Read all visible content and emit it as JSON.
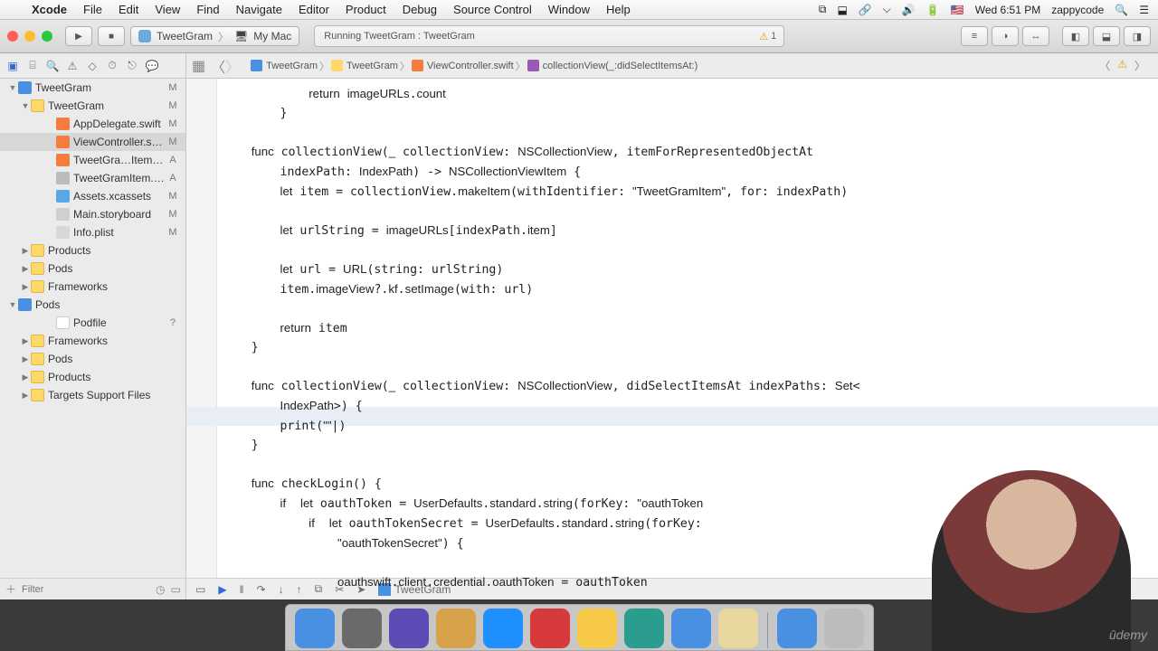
{
  "menubar": {
    "app": "Xcode",
    "items": [
      "File",
      "Edit",
      "View",
      "Find",
      "Navigate",
      "Editor",
      "Product",
      "Debug",
      "Source Control",
      "Window",
      "Help"
    ],
    "clock": "Wed 6:51 PM",
    "user": "zappycode",
    "flag": "🇺🇸"
  },
  "toolbar": {
    "scheme_name": "TweetGram",
    "destination": "My Mac",
    "activity": "Running TweetGram : TweetGram",
    "warning_count": "1"
  },
  "jumpbar": {
    "segments": [
      "TweetGram",
      "TweetGram",
      "ViewController.swift",
      "collectionView(_:didSelectItemsAt:)"
    ]
  },
  "navigator": {
    "items": [
      {
        "name": "TweetGram",
        "icon": "proj",
        "status": "M",
        "indent": "ind1",
        "disc": "▼"
      },
      {
        "name": "TweetGram",
        "icon": "fold",
        "status": "M",
        "indent": "ind2",
        "disc": "▼"
      },
      {
        "name": "AppDelegate.swift",
        "icon": "swift",
        "status": "M",
        "indent": "ind3b",
        "disc": ""
      },
      {
        "name": "ViewController.swift",
        "icon": "swift",
        "status": "M",
        "indent": "ind3b",
        "disc": "",
        "sel": true
      },
      {
        "name": "TweetGra…Item.swift",
        "icon": "swift",
        "status": "A",
        "indent": "ind3b",
        "disc": ""
      },
      {
        "name": "TweetGramItem.xib",
        "icon": "xib",
        "status": "A",
        "indent": "ind3b",
        "disc": ""
      },
      {
        "name": "Assets.xcassets",
        "icon": "xc",
        "status": "M",
        "indent": "ind3b",
        "disc": ""
      },
      {
        "name": "Main.storyboard",
        "icon": "sb",
        "status": "M",
        "indent": "ind3b",
        "disc": ""
      },
      {
        "name": "Info.plist",
        "icon": "plist",
        "status": "M",
        "indent": "ind3b",
        "disc": ""
      },
      {
        "name": "Products",
        "icon": "fold",
        "status": "",
        "indent": "ind2",
        "disc": "▶"
      },
      {
        "name": "Pods",
        "icon": "fold",
        "status": "",
        "indent": "ind2",
        "disc": "▶"
      },
      {
        "name": "Frameworks",
        "icon": "fold",
        "status": "",
        "indent": "ind2",
        "disc": "▶"
      },
      {
        "name": "Pods",
        "icon": "proj",
        "status": "",
        "indent": "ind1",
        "disc": "▼"
      },
      {
        "name": "Podfile",
        "icon": "white",
        "status": "?",
        "indent": "ind3b",
        "disc": ""
      },
      {
        "name": "Frameworks",
        "icon": "fold",
        "status": "",
        "indent": "ind2",
        "disc": "▶"
      },
      {
        "name": "Pods",
        "icon": "fold",
        "status": "",
        "indent": "ind2",
        "disc": "▶"
      },
      {
        "name": "Products",
        "icon": "fold",
        "status": "",
        "indent": "ind2",
        "disc": "▶"
      },
      {
        "name": "Targets Support Files",
        "icon": "fold",
        "status": "",
        "indent": "ind2",
        "disc": "▶"
      }
    ],
    "filter_placeholder": "Filter"
  },
  "debugbar": {
    "scheme": "TweetGram"
  },
  "code_lines": [
    {
      "t": "            <kw>return</kw> <mb>imageURLs</mb>.<pr>count</pr>"
    },
    {
      "t": "        }"
    },
    {
      "t": ""
    },
    {
      "t": "    <kw>func</kw> collectionView(<kw>_</kw> collectionView: <ty>NSCollectionView</ty>, itemForRepresentedObjectAt"
    },
    {
      "t": "        indexPath: <ty>IndexPath</ty>) -> <ty>NSCollectionViewItem</ty> {"
    },
    {
      "t": "        <kw>let</kw> item = collectionView.<pr>makeItem</pr>(withIdentifier: <st>\"TweetGramItem\"</st>, for: indexPath)"
    },
    {
      "t": ""
    },
    {
      "t": "        <kw>let</kw> urlString = <mb>imageURLs</mb>[indexPath.<pr>item</pr>]"
    },
    {
      "t": ""
    },
    {
      "t": "        <kw>let</kw> url = <ty>URL</ty>(string: urlString)"
    },
    {
      "t": "        item.<pr>imageView</pr>?.<pr>kf</pr>.<pr>setImage</pr>(with: url)"
    },
    {
      "t": ""
    },
    {
      "t": "        <kw>return</kw> item"
    },
    {
      "t": "    }"
    },
    {
      "t": ""
    },
    {
      "t": "    <kw>func</kw> collectionView(<kw>_</kw> collectionView: <ty>NSCollectionView</ty>, didSelectItemsAt indexPaths: <ty>Set</ty>&lt;"
    },
    {
      "t": "        <ty>IndexPath</ty>&gt;) {"
    },
    {
      "t": "        print(<st>\"\"</st>|)",
      "hl": true
    },
    {
      "t": "    }"
    },
    {
      "t": ""
    },
    {
      "t": "    <kw>func</kw> checkLogin() {"
    },
    {
      "t": "        <kw>if</kw>  <kw>let</kw> oauthToken = <ty>UserDefaults</ty>.<pr>standard</pr>.<pr>string</pr>(forKey: <st>\"oauthToken</st>"
    },
    {
      "t": "            <kw>if</kw>  <kw>let</kw> oauthTokenSecret = <ty>UserDefaults</ty>.<pr>standard</pr>.<pr>string</pr>(forKey:"
    },
    {
      "t": "                <st>\"oauthTokenSecret\"</st>) {"
    },
    {
      "t": ""
    },
    {
      "t": "                <pr>oauthswift</pr>.<pr>client</pr>.<pr>credential</pr>.<pr>oauthToken</pr> = oauthToken"
    }
  ],
  "dock_colors": [
    "#4a90e2",
    "#6a6a6a",
    "#5b4db5",
    "#d8a24a",
    "#1e90ff",
    "#d63a3a",
    "#f7c948",
    "#2a9d8f",
    "#4a90e2",
    "#e8d8a0",
    "#4a90e2",
    "#bcbcbc"
  ]
}
